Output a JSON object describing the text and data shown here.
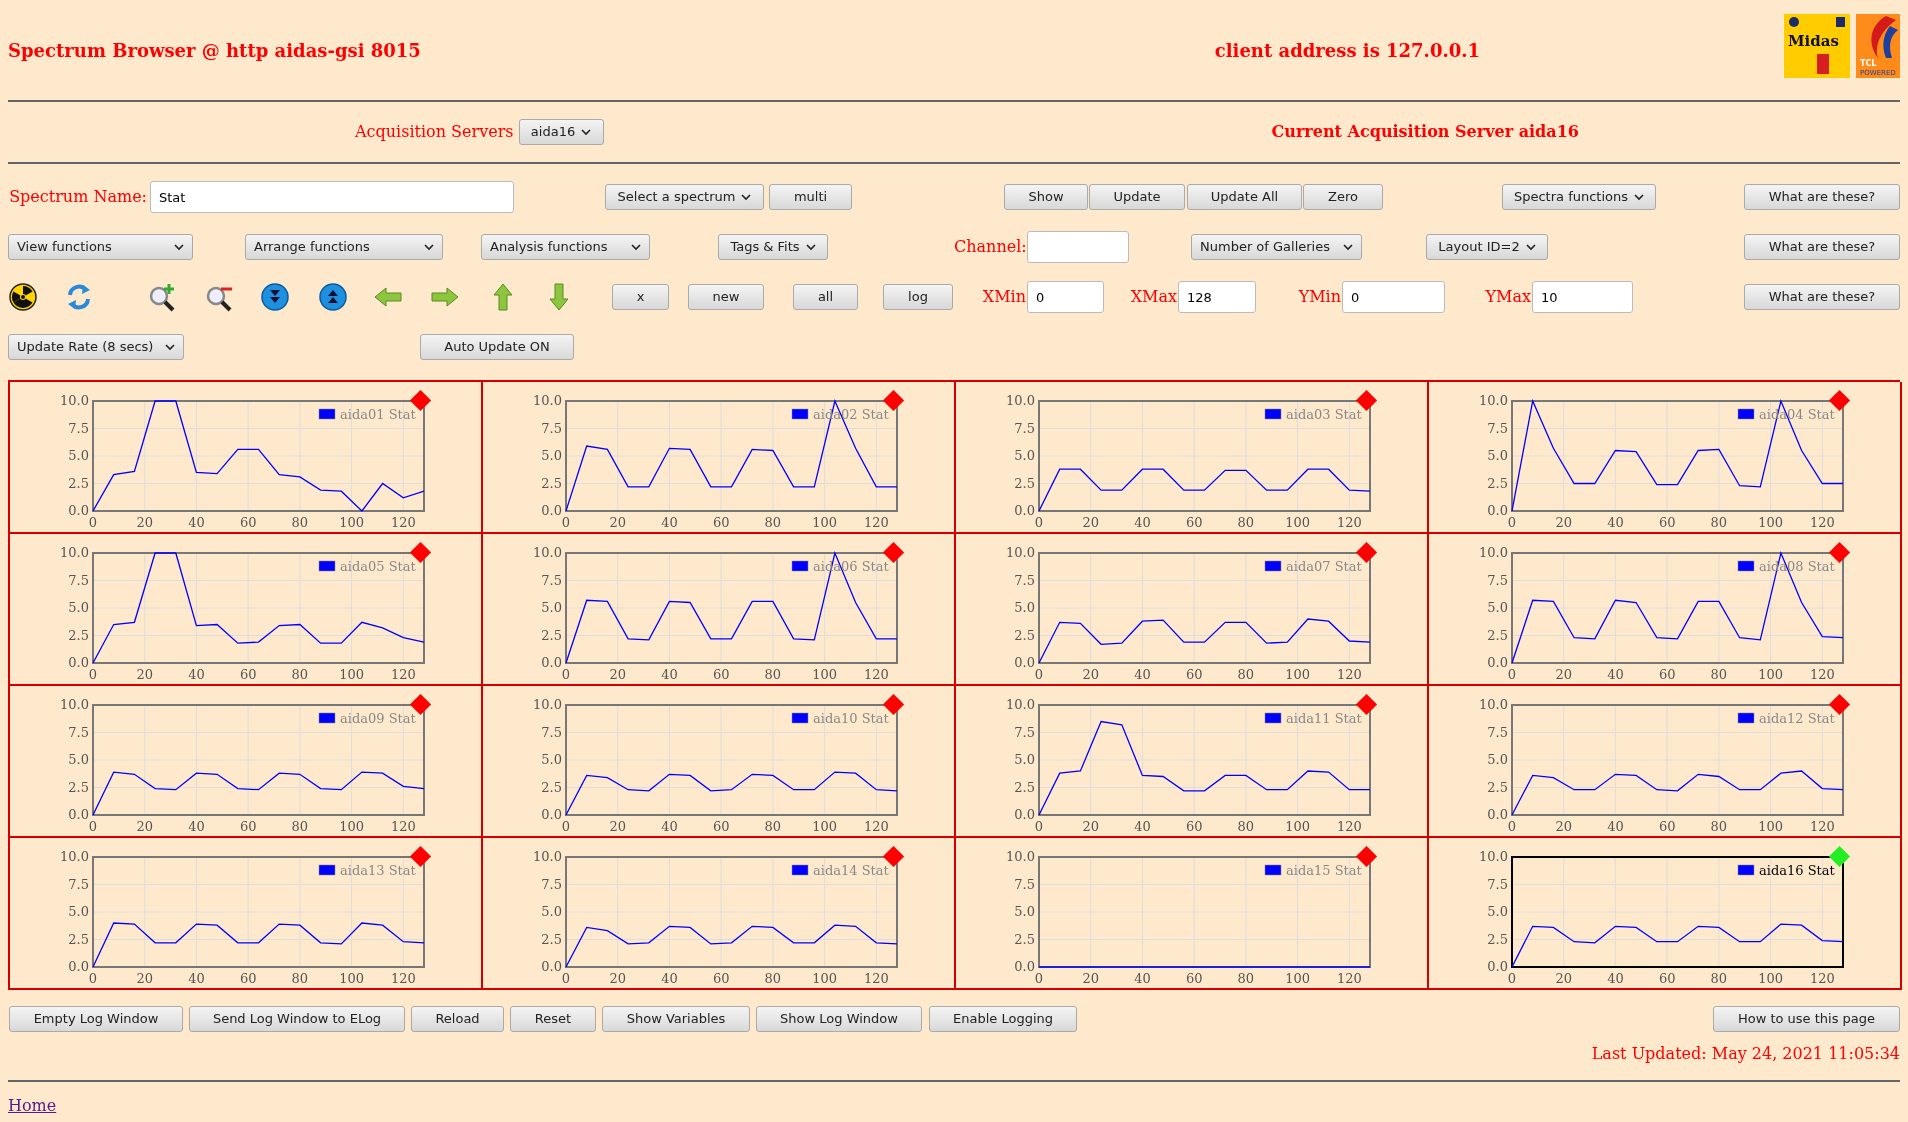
{
  "header": {
    "title": "Spectrum Browser @ http aidas-gsi 8015",
    "client_address": "client address is 127.0.0.1",
    "midas_logo": "Midas",
    "tcl_logo": [
      "TCL",
      "POWERED"
    ]
  },
  "acquisition": {
    "label": "Acquisition Servers",
    "server": "aida16",
    "current": "Current Acquisition Server aida16"
  },
  "rows": [
    [
      {
        "kind": "label",
        "text": "Spectrum Name:"
      },
      {
        "kind": "input",
        "value": "Stat"
      },
      {
        "kind": "dropdown",
        "text": "Select a spectrum"
      },
      {
        "kind": "button",
        "text": "multi"
      },
      {
        "kind": "button",
        "text": "Show"
      },
      {
        "kind": "button",
        "text": "Update"
      },
      {
        "kind": "button",
        "text": "Update All"
      },
      {
        "kind": "button",
        "text": "Zero"
      },
      {
        "kind": "dropdown",
        "text": "Spectra functions"
      },
      {
        "kind": "button",
        "text": "What are these?"
      }
    ],
    [
      {
        "kind": "dropdown",
        "text": "View functions"
      },
      {
        "kind": "dropdown",
        "text": "Arrange functions"
      },
      {
        "kind": "dropdown",
        "text": "Analysis functions"
      },
      {
        "kind": "dropdown",
        "text": "Tags & Fits"
      },
      {
        "kind": "label",
        "text": "Channel:"
      },
      {
        "kind": "input"
      },
      {
        "kind": "dropdown",
        "text": "Number of Galleries"
      },
      {
        "kind": "dropdown",
        "text": "Layout ID=2"
      },
      {
        "kind": "button",
        "text": "What are these?"
      }
    ],
    [
      {
        "kind": "icon"
      },
      {
        "kind": "icon"
      },
      {
        "kind": "icon"
      },
      {
        "kind": "icon"
      },
      {
        "kind": "icon"
      },
      {
        "kind": "icon"
      },
      {
        "kind": "icon"
      },
      {
        "kind": "icon"
      },
      {
        "kind": "icon"
      },
      {
        "kind": "icon"
      },
      {
        "kind": "button",
        "text": "x"
      },
      {
        "kind": "button",
        "text": "new"
      },
      {
        "kind": "button",
        "text": "all"
      },
      {
        "kind": "button",
        "text": "log"
      },
      {
        "kind": "label",
        "text": "XMin"
      },
      {
        "kind": "input",
        "value": "0"
      },
      {
        "kind": "label",
        "text": "XMax"
      },
      {
        "kind": "input",
        "value": "128"
      },
      {
        "kind": "label",
        "text": "YMin"
      },
      {
        "kind": "input",
        "value": "0"
      },
      {
        "kind": "label",
        "text": "YMax"
      },
      {
        "kind": "input",
        "value": "10"
      },
      {
        "kind": "button",
        "text": "What are these?"
      }
    ],
    [
      {
        "kind": "dropdown",
        "text": "Update Rate (8 secs)"
      },
      {
        "kind": "button",
        "text": "Auto Update ON"
      }
    ]
  ],
  "panels": [
    {
      "selected": false,
      "chart_data": {
        "type": "line",
        "grid": true,
        "xlim": [
          0,
          128
        ],
        "ylim": [
          0,
          10
        ],
        "xticks": [
          0,
          20,
          40,
          60,
          80,
          100,
          120
        ],
        "yticks": [
          {
            "value": 0,
            "label": "0.0"
          },
          {
            "value": 2.5,
            "label": "2.5"
          },
          {
            "value": 5,
            "label": "5.0"
          },
          {
            "value": 7.5,
            "label": "7.5"
          },
          {
            "value": 10,
            "label": "10.0"
          }
        ],
        "x": [
          0,
          8,
          16,
          24,
          32,
          40,
          48,
          56,
          64,
          72,
          80,
          88,
          96,
          104,
          112,
          120,
          128
        ],
        "series": [
          {
            "name": "aida01 Stat",
            "color": "#0000ff",
            "values": [
              0,
              3.3,
              3.6,
              10,
              10,
              3.5,
              3.4,
              5.6,
              5.6,
              3.3,
              3.1,
              1.9,
              1.8,
              0,
              2.5,
              1.2,
              1.8
            ]
          }
        ]
      }
    },
    {
      "selected": false,
      "chart_data": {
        "type": "line",
        "xlim": [
          0,
          128
        ],
        "ylim": [
          0,
          10
        ],
        "xticks": [
          0,
          20,
          40,
          60,
          80,
          100,
          120
        ],
        "yticks": [
          {
            "value": 0,
            "label": "0.0"
          },
          {
            "value": 2.5,
            "label": "2.5"
          },
          {
            "value": 5,
            "label": "5.0"
          },
          {
            "value": 7.5,
            "label": "7.5"
          },
          {
            "value": 10,
            "label": "10.0"
          }
        ],
        "x": [
          0,
          8,
          16,
          24,
          32,
          40,
          48,
          56,
          64,
          72,
          80,
          88,
          96,
          104,
          112,
          120,
          128
        ],
        "grid": true,
        "series": [
          {
            "name": "aida02 Stat",
            "color": "#0000ff",
            "values": [
              0,
              5.9,
              5.6,
              2.2,
              2.2,
              5.7,
              5.6,
              2.2,
              2.2,
              5.6,
              5.5,
              2.2,
              2.2,
              10,
              5.7,
              2.2,
              2.2
            ]
          }
        ]
      }
    },
    {
      "selected": false,
      "chart_data": {
        "type": "line",
        "xlim": [
          0,
          128
        ],
        "ylim": [
          0,
          10
        ],
        "xticks": [
          0,
          20,
          40,
          60,
          80,
          100,
          120
        ],
        "yticks": [
          {
            "value": 0,
            "label": "0.0"
          },
          {
            "value": 2.5,
            "label": "2.5"
          },
          {
            "value": 5,
            "label": "5.0"
          },
          {
            "value": 7.5,
            "label": "7.5"
          },
          {
            "value": 10,
            "label": "10.0"
          }
        ],
        "x": [
          0,
          8,
          16,
          24,
          32,
          40,
          48,
          56,
          64,
          72,
          80,
          88,
          96,
          104,
          112,
          120,
          128
        ],
        "grid": true,
        "series": [
          {
            "name": "aida03 Stat",
            "color": "#0000ff",
            "values": [
              0,
              3.8,
              3.8,
              1.9,
              1.9,
              3.8,
              3.8,
              1.9,
              1.9,
              3.7,
              3.7,
              1.9,
              1.9,
              3.8,
              3.8,
              1.9,
              1.8
            ]
          }
        ]
      }
    },
    {
      "selected": false,
      "chart_data": {
        "type": "line",
        "xlim": [
          0,
          128
        ],
        "ylim": [
          0,
          10
        ],
        "xticks": [
          0,
          20,
          40,
          60,
          80,
          100,
          120
        ],
        "yticks": [
          {
            "value": 0,
            "label": "0.0"
          },
          {
            "value": 2.5,
            "label": "2.5"
          },
          {
            "value": 5,
            "label": "5.0"
          },
          {
            "value": 7.5,
            "label": "7.5"
          },
          {
            "value": 10,
            "label": "10.0"
          }
        ],
        "x": [
          0,
          8,
          16,
          24,
          32,
          40,
          48,
          56,
          64,
          72,
          80,
          88,
          96,
          104,
          112,
          120,
          128
        ],
        "grid": true,
        "series": [
          {
            "name": "aida04 Stat",
            "color": "#0000ff",
            "values": [
              0,
              10,
              5.7,
              2.5,
              2.5,
              5.5,
              5.4,
              2.4,
              2.4,
              5.5,
              5.6,
              2.3,
              2.2,
              10,
              5.5,
              2.5,
              2.5
            ]
          }
        ]
      }
    },
    {
      "selected": false,
      "chart_data": {
        "type": "line",
        "xlim": [
          0,
          128
        ],
        "ylim": [
          0,
          10
        ],
        "xticks": [
          0,
          20,
          40,
          60,
          80,
          100,
          120
        ],
        "yticks": [
          {
            "value": 0,
            "label": "0.0"
          },
          {
            "value": 2.5,
            "label": "2.5"
          },
          {
            "value": 5,
            "label": "5.0"
          },
          {
            "value": 7.5,
            "label": "7.5"
          },
          {
            "value": 10,
            "label": "10.0"
          }
        ],
        "x": [
          0,
          8,
          16,
          24,
          32,
          40,
          48,
          56,
          64,
          72,
          80,
          88,
          96,
          104,
          112,
          120,
          128
        ],
        "grid": true,
        "series": [
          {
            "name": "aida05 Stat",
            "color": "#0000ff",
            "values": [
              0,
              3.5,
              3.7,
              10,
              10,
              3.4,
              3.5,
              1.8,
              1.9,
              3.4,
              3.5,
              1.8,
              1.8,
              3.7,
              3.2,
              2.3,
              1.9
            ]
          }
        ]
      }
    },
    {
      "selected": false,
      "chart_data": {
        "type": "line",
        "xlim": [
          0,
          128
        ],
        "ylim": [
          0,
          10
        ],
        "xticks": [
          0,
          20,
          40,
          60,
          80,
          100,
          120
        ],
        "yticks": [
          {
            "value": 0,
            "label": "0.0"
          },
          {
            "value": 2.5,
            "label": "2.5"
          },
          {
            "value": 5,
            "label": "5.0"
          },
          {
            "value": 7.5,
            "label": "7.5"
          },
          {
            "value": 10,
            "label": "10.0"
          }
        ],
        "x": [
          0,
          8,
          16,
          24,
          32,
          40,
          48,
          56,
          64,
          72,
          80,
          88,
          96,
          104,
          112,
          120,
          128
        ],
        "grid": true,
        "series": [
          {
            "name": "aida06 Stat",
            "color": "#0000ff",
            "values": [
              0,
              5.7,
              5.6,
              2.2,
              2.1,
              5.6,
              5.5,
              2.2,
              2.2,
              5.6,
              5.6,
              2.2,
              2.1,
              10,
              5.5,
              2.2,
              2.2
            ]
          }
        ]
      }
    },
    {
      "selected": false,
      "chart_data": {
        "type": "line",
        "xlim": [
          0,
          128
        ],
        "ylim": [
          0,
          10
        ],
        "xticks": [
          0,
          20,
          40,
          60,
          80,
          100,
          120
        ],
        "yticks": [
          {
            "value": 0,
            "label": "0.0"
          },
          {
            "value": 2.5,
            "label": "2.5"
          },
          {
            "value": 5,
            "label": "5.0"
          },
          {
            "value": 7.5,
            "label": "7.5"
          },
          {
            "value": 10,
            "label": "10.0"
          }
        ],
        "x": [
          0,
          8,
          16,
          24,
          32,
          40,
          48,
          56,
          64,
          72,
          80,
          88,
          96,
          104,
          112,
          120,
          128
        ],
        "grid": true,
        "series": [
          {
            "name": "aida07 Stat",
            "color": "#0000ff",
            "values": [
              0,
              3.7,
              3.6,
              1.7,
              1.8,
              3.8,
              3.9,
              1.9,
              1.9,
              3.7,
              3.7,
              1.8,
              1.9,
              4.0,
              3.8,
              2.0,
              1.9
            ]
          }
        ]
      }
    },
    {
      "selected": false,
      "chart_data": {
        "type": "line",
        "xlim": [
          0,
          128
        ],
        "ylim": [
          0,
          10
        ],
        "xticks": [
          0,
          20,
          40,
          60,
          80,
          100,
          120
        ],
        "yticks": [
          {
            "value": 0,
            "label": "0.0"
          },
          {
            "value": 2.5,
            "label": "2.5"
          },
          {
            "value": 5,
            "label": "5.0"
          },
          {
            "value": 7.5,
            "label": "7.5"
          },
          {
            "value": 10,
            "label": "10.0"
          }
        ],
        "x": [
          0,
          8,
          16,
          24,
          32,
          40,
          48,
          56,
          64,
          72,
          80,
          88,
          96,
          104,
          112,
          120,
          128
        ],
        "grid": true,
        "series": [
          {
            "name": "aida08 Stat",
            "color": "#0000ff",
            "values": [
              0,
              5.7,
              5.6,
              2.3,
              2.2,
              5.7,
              5.5,
              2.3,
              2.2,
              5.6,
              5.6,
              2.3,
              2.1,
              10,
              5.5,
              2.4,
              2.3
            ]
          }
        ]
      }
    },
    {
      "selected": false,
      "chart_data": {
        "type": "line",
        "xlim": [
          0,
          128
        ],
        "ylim": [
          0,
          10
        ],
        "xticks": [
          0,
          20,
          40,
          60,
          80,
          100,
          120
        ],
        "yticks": [
          {
            "value": 0,
            "label": "0.0"
          },
          {
            "value": 2.5,
            "label": "2.5"
          },
          {
            "value": 5,
            "label": "5.0"
          },
          {
            "value": 7.5,
            "label": "7.5"
          },
          {
            "value": 10,
            "label": "10.0"
          }
        ],
        "x": [
          0,
          8,
          16,
          24,
          32,
          40,
          48,
          56,
          64,
          72,
          80,
          88,
          96,
          104,
          112,
          120,
          128
        ],
        "grid": true,
        "series": [
          {
            "name": "aida09 Stat",
            "color": "#0000ff",
            "values": [
              0,
              3.9,
              3.7,
              2.4,
              2.3,
              3.8,
              3.7,
              2.4,
              2.3,
              3.8,
              3.7,
              2.4,
              2.3,
              3.9,
              3.8,
              2.6,
              2.4
            ]
          }
        ]
      }
    },
    {
      "selected": false,
      "chart_data": {
        "type": "line",
        "xlim": [
          0,
          128
        ],
        "ylim": [
          0,
          10
        ],
        "xticks": [
          0,
          20,
          40,
          60,
          80,
          100,
          120
        ],
        "yticks": [
          {
            "value": 0,
            "label": "0.0"
          },
          {
            "value": 2.5,
            "label": "2.5"
          },
          {
            "value": 5,
            "label": "5.0"
          },
          {
            "value": 7.5,
            "label": "7.5"
          },
          {
            "value": 10,
            "label": "10.0"
          }
        ],
        "x": [
          0,
          8,
          16,
          24,
          32,
          40,
          48,
          56,
          64,
          72,
          80,
          88,
          96,
          104,
          112,
          120,
          128
        ],
        "grid": true,
        "series": [
          {
            "name": "aida10 Stat",
            "color": "#0000ff",
            "values": [
              0,
              3.6,
              3.4,
              2.3,
              2.2,
              3.7,
              3.6,
              2.2,
              2.3,
              3.7,
              3.6,
              2.3,
              2.3,
              3.9,
              3.8,
              2.3,
              2.2
            ]
          }
        ]
      }
    },
    {
      "selected": false,
      "chart_data": {
        "type": "line",
        "xlim": [
          0,
          128
        ],
        "ylim": [
          0,
          10
        ],
        "xticks": [
          0,
          20,
          40,
          60,
          80,
          100,
          120
        ],
        "yticks": [
          {
            "value": 0,
            "label": "0.0"
          },
          {
            "value": 2.5,
            "label": "2.5"
          },
          {
            "value": 5,
            "label": "5.0"
          },
          {
            "value": 7.5,
            "label": "7.5"
          },
          {
            "value": 10,
            "label": "10.0"
          }
        ],
        "x": [
          0,
          8,
          16,
          24,
          32,
          40,
          48,
          56,
          64,
          72,
          80,
          88,
          96,
          104,
          112,
          120,
          128
        ],
        "grid": true,
        "series": [
          {
            "name": "aida11 Stat",
            "color": "#0000ff",
            "values": [
              0,
              3.8,
              4.0,
              8.5,
              8.2,
              3.6,
              3.5,
              2.2,
              2.2,
              3.6,
              3.6,
              2.3,
              2.3,
              4.0,
              3.9,
              2.3,
              2.3
            ]
          }
        ]
      }
    },
    {
      "selected": false,
      "chart_data": {
        "type": "line",
        "xlim": [
          0,
          128
        ],
        "ylim": [
          0,
          10
        ],
        "xticks": [
          0,
          20,
          40,
          60,
          80,
          100,
          120
        ],
        "yticks": [
          {
            "value": 0,
            "label": "0.0"
          },
          {
            "value": 2.5,
            "label": "2.5"
          },
          {
            "value": 5,
            "label": "5.0"
          },
          {
            "value": 7.5,
            "label": "7.5"
          },
          {
            "value": 10,
            "label": "10.0"
          }
        ],
        "x": [
          0,
          8,
          16,
          24,
          32,
          40,
          48,
          56,
          64,
          72,
          80,
          88,
          96,
          104,
          112,
          120,
          128
        ],
        "grid": true,
        "series": [
          {
            "name": "aida12 Stat",
            "color": "#0000ff",
            "values": [
              0,
              3.6,
              3.4,
              2.3,
              2.3,
              3.7,
              3.6,
              2.3,
              2.2,
              3.7,
              3.5,
              2.3,
              2.3,
              3.8,
              4.0,
              2.4,
              2.3
            ]
          }
        ]
      }
    },
    {
      "selected": false,
      "chart_data": {
        "type": "line",
        "xlim": [
          0,
          128
        ],
        "ylim": [
          0,
          10
        ],
        "xticks": [
          0,
          20,
          40,
          60,
          80,
          100,
          120
        ],
        "yticks": [
          {
            "value": 0,
            "label": "0.0"
          },
          {
            "value": 2.5,
            "label": "2.5"
          },
          {
            "value": 5,
            "label": "5.0"
          },
          {
            "value": 7.5,
            "label": "7.5"
          },
          {
            "value": 10,
            "label": "10.0"
          }
        ],
        "x": [
          0,
          8,
          16,
          24,
          32,
          40,
          48,
          56,
          64,
          72,
          80,
          88,
          96,
          104,
          112,
          120,
          128
        ],
        "grid": true,
        "series": [
          {
            "name": "aida13 Stat",
            "color": "#0000ff",
            "values": [
              0,
              4.0,
              3.9,
              2.2,
              2.2,
              3.9,
              3.8,
              2.2,
              2.2,
              3.9,
              3.8,
              2.2,
              2.1,
              4.0,
              3.8,
              2.3,
              2.2
            ]
          }
        ]
      }
    },
    {
      "selected": false,
      "chart_data": {
        "type": "line",
        "xlim": [
          0,
          128
        ],
        "ylim": [
          0,
          10
        ],
        "xticks": [
          0,
          20,
          40,
          60,
          80,
          100,
          120
        ],
        "yticks": [
          {
            "value": 0,
            "label": "0.0"
          },
          {
            "value": 2.5,
            "label": "2.5"
          },
          {
            "value": 5,
            "label": "5.0"
          },
          {
            "value": 7.5,
            "label": "7.5"
          },
          {
            "value": 10,
            "label": "10.0"
          }
        ],
        "x": [
          0,
          8,
          16,
          24,
          32,
          40,
          48,
          56,
          64,
          72,
          80,
          88,
          96,
          104,
          112,
          120,
          128
        ],
        "grid": true,
        "series": [
          {
            "name": "aida14 Stat",
            "color": "#0000ff",
            "values": [
              0,
              3.6,
              3.3,
              2.1,
              2.2,
              3.7,
              3.6,
              2.1,
              2.2,
              3.7,
              3.6,
              2.2,
              2.2,
              3.8,
              3.7,
              2.2,
              2.1
            ]
          }
        ]
      }
    },
    {
      "selected": false,
      "chart_data": {
        "type": "line",
        "xlim": [
          0,
          128
        ],
        "ylim": [
          0,
          10
        ],
        "xticks": [
          0,
          20,
          40,
          60,
          80,
          100,
          120
        ],
        "yticks": [
          {
            "value": 0,
            "label": "0.0"
          },
          {
            "value": 2.5,
            "label": "2.5"
          },
          {
            "value": 5,
            "label": "5.0"
          },
          {
            "value": 7.5,
            "label": "7.5"
          },
          {
            "value": 10,
            "label": "10.0"
          }
        ],
        "x": [
          0,
          8,
          16,
          24,
          32,
          40,
          48,
          56,
          64,
          72,
          80,
          88,
          96,
          104,
          112,
          120,
          128
        ],
        "grid": true,
        "series": [
          {
            "name": "aida15 Stat",
            "color": "#0000ff",
            "values": [
              0,
              0,
              0,
              0,
              0,
              0,
              0,
              0,
              0,
              0,
              0,
              0,
              0,
              0,
              0,
              0,
              0
            ]
          }
        ]
      }
    },
    {
      "selected": true,
      "chart_data": {
        "type": "line",
        "xlim": [
          0,
          128
        ],
        "ylim": [
          0,
          10
        ],
        "xticks": [
          0,
          20,
          40,
          60,
          80,
          100,
          120
        ],
        "yticks": [
          {
            "value": 0,
            "label": "0.0"
          },
          {
            "value": 2.5,
            "label": "2.5"
          },
          {
            "value": 5,
            "label": "5.0"
          },
          {
            "value": 7.5,
            "label": "7.5"
          },
          {
            "value": 10,
            "label": "10.0"
          }
        ],
        "x": [
          0,
          8,
          16,
          24,
          32,
          40,
          48,
          56,
          64,
          72,
          80,
          88,
          96,
          104,
          112,
          120,
          128
        ],
        "grid": true,
        "series": [
          {
            "name": "aida16 Stat",
            "color": "#0000ff",
            "values": [
              0,
              3.7,
              3.6,
              2.3,
              2.2,
              3.7,
              3.6,
              2.3,
              2.3,
              3.7,
              3.6,
              2.3,
              2.3,
              3.9,
              3.8,
              2.4,
              2.3
            ]
          }
        ]
      }
    }
  ],
  "bottom_buttons": [
    "Empty Log Window",
    "Send Log Window to ELog",
    "Reload",
    "Reset",
    "Show Variables",
    "Show Log Window",
    "Enable Logging"
  ],
  "help_button": "How to use this page",
  "last_updated": "Last Updated: May 24, 2021 11:05:34",
  "home_link": "Home"
}
